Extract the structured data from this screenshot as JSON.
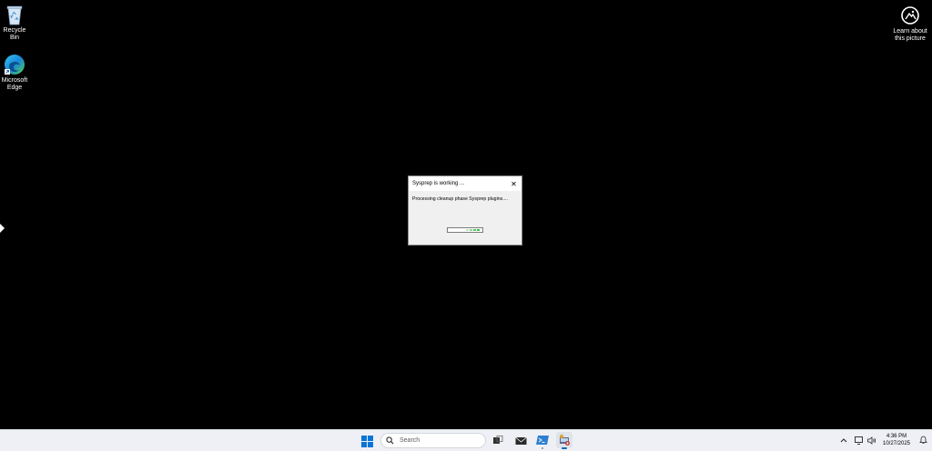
{
  "desktop": {
    "icons": [
      {
        "label": "Recycle Bin",
        "icon": "recycle-bin-icon"
      },
      {
        "label_line1": "Microsoft",
        "label_line2": "Edge",
        "icon": "edge-icon"
      }
    ],
    "learn": {
      "line1": "Learn about",
      "line2": "this picture",
      "icon": "learn-about-picture-icon"
    }
  },
  "dialog": {
    "title": "Sysprep is working ...",
    "close_label": "✕",
    "message": "Processing cleanup phase Sysprep plugins....",
    "progress_color": "#3cc24a"
  },
  "taskbar": {
    "search_placeholder": "Search",
    "items": [
      "start-icon",
      "search-icon",
      "task-view-icon",
      "mail-icon",
      "powershell-icon",
      "sysprep-icon"
    ],
    "tray": [
      "chevron-up-icon",
      "network-icon",
      "volume-icon",
      "notification-icon"
    ],
    "time": "4:36 PM",
    "date": "10/27/2025"
  }
}
